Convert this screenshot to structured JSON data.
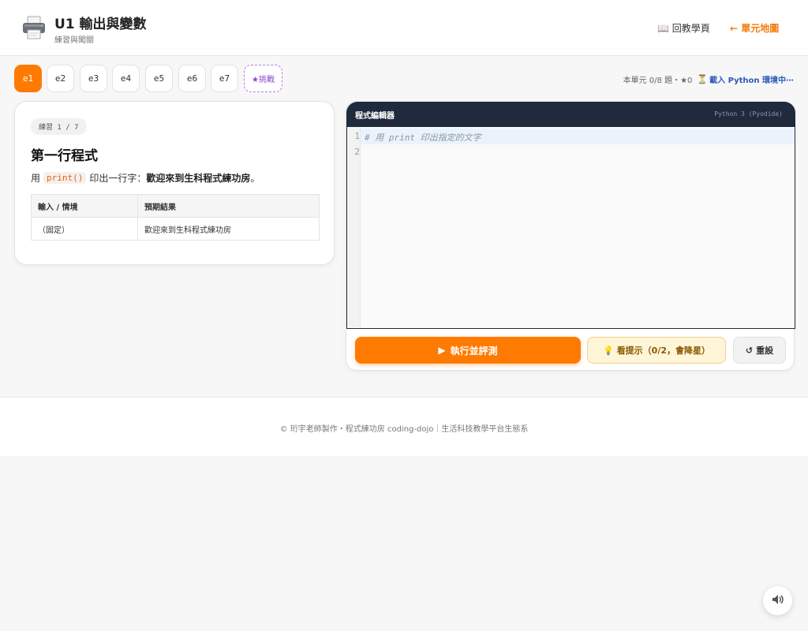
{
  "header": {
    "title": "U1 輸出與變數",
    "subtitle": "練習與闖關",
    "logo_icon": "printer-icon",
    "nav_home": "📖 回教學頁",
    "nav_map": "← 單元地圖"
  },
  "tabs": [
    {
      "label": "e1",
      "active": true
    },
    {
      "label": "e2"
    },
    {
      "label": "e3"
    },
    {
      "label": "e4"
    },
    {
      "label": "e5"
    },
    {
      "label": "e6"
    },
    {
      "label": "e7"
    }
  ],
  "challenge_tab": "★挑戰",
  "status": {
    "progress": "本單元 0/8 題・★0",
    "loading_icon": "hourglass-icon",
    "loading": "載入 Python 環境中⋯"
  },
  "exercise": {
    "badge": "練習 1 / 7",
    "title": "第一行程式",
    "desc_prefix": "用",
    "desc_code": "print()",
    "desc_middle": "印出一行字：",
    "desc_bold": "歡迎來到生科程式練功房",
    "desc_suffix": "。",
    "table": {
      "headers": [
        "輸入 / 情境",
        "預期結果"
      ],
      "rows": [
        [
          "（固定）",
          "歡迎來到生科程式練功房"
        ]
      ]
    }
  },
  "editor": {
    "title": "程式編輯器",
    "lang": "Python 3 (Pyodide)",
    "lines": [
      "# 用 print 印出指定的文字",
      ""
    ],
    "line_numbers": [
      "1",
      "2"
    ]
  },
  "buttons": {
    "run": "執行並評測",
    "run_icon": "play-icon",
    "hint": "看提示（0/2，會降星）",
    "hint_icon": "lightbulb-icon",
    "reset": "重設",
    "reset_icon": "reset-icon"
  },
  "footer": {
    "text": "© 珩宇老師製作・程式練功房 coding-dojo｜生活科技教學平台生態系"
  },
  "sound_icon": "speaker-icon",
  "colors": {
    "accent": "#ff7a00",
    "editor_header": "#1f2a3c",
    "challenge": "#8f44cf",
    "loading": "#2a5ab8"
  }
}
